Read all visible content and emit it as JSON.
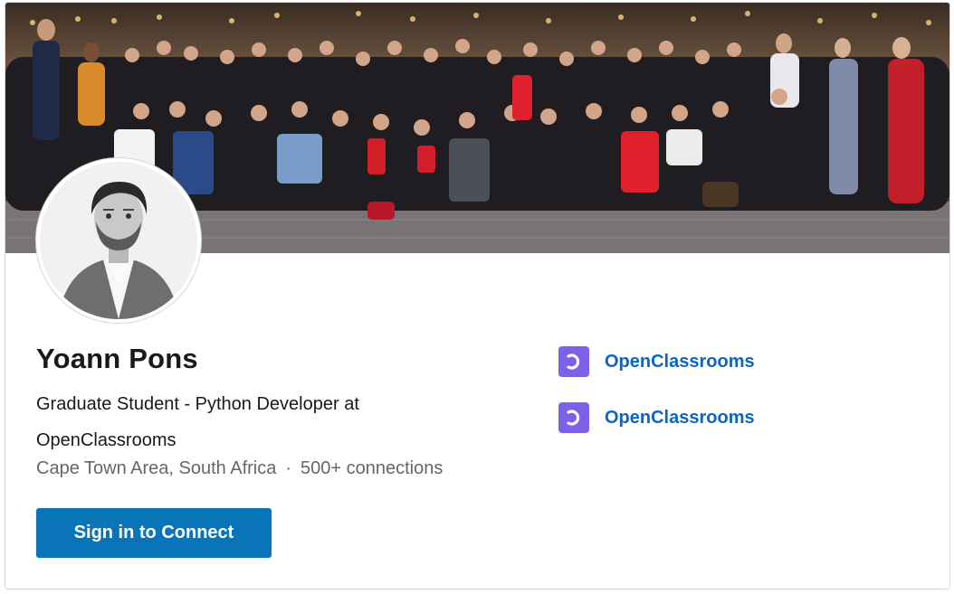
{
  "profile": {
    "name": "Yoann Pons",
    "headline": "Graduate Student - Python Developer at OpenClassrooms",
    "location": "Cape Town Area, South Africa",
    "separator": "·",
    "connections": "500+ connections"
  },
  "actions": {
    "sign_in_label": "Sign in to Connect"
  },
  "organizations": [
    {
      "name": "OpenClassrooms",
      "logo": "openclassrooms-logo-icon"
    },
    {
      "name": "OpenClassrooms",
      "logo": "openclassrooms-logo-icon"
    }
  ],
  "colors": {
    "button": "#0a74b9",
    "link": "#0a66c2",
    "logo_background": "#7b61e8",
    "secondary_text": "#666666"
  }
}
